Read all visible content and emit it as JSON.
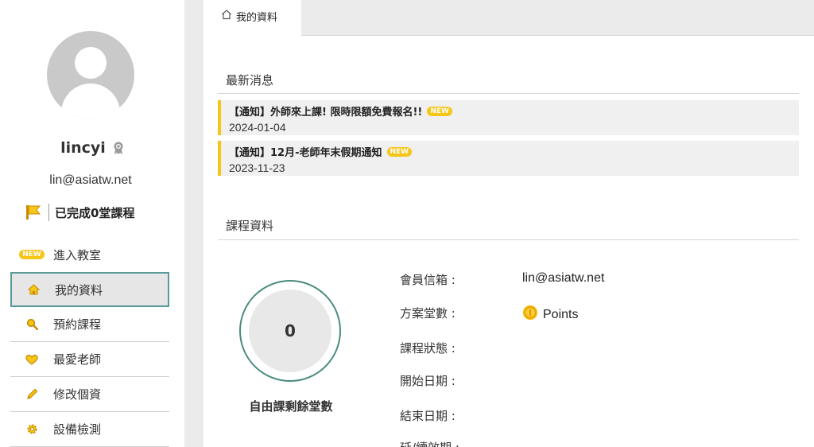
{
  "user": {
    "username": "lincyi",
    "email": "lin@asiatw.net",
    "completed_text": "已完成0堂課程"
  },
  "menu": [
    {
      "label": "進入教室",
      "icon": "new-badge",
      "badge": "NEW"
    },
    {
      "label": "我的資料",
      "icon": "home-icon"
    },
    {
      "label": "預約課程",
      "icon": "search-icon"
    },
    {
      "label": "最愛老師",
      "icon": "heart-icon"
    },
    {
      "label": "修改個資",
      "icon": "pencil-icon"
    },
    {
      "label": "設備檢測",
      "icon": "gear-icon"
    }
  ],
  "tab": {
    "label": "我的資料"
  },
  "news": {
    "title": "最新消息",
    "items": [
      {
        "title": "【通知】外師來上課! 限時限額免費報名!!",
        "date": "2024-01-04",
        "badge": "NEW"
      },
      {
        "title": "【通知】12月-老師年末假期通知",
        "date": "2023-11-23",
        "badge": "NEW"
      }
    ]
  },
  "course": {
    "title": "課程資料",
    "remaining_count": "0",
    "remaining_label": "自由課剩餘堂數",
    "fields": [
      {
        "label": "會員信箱 :",
        "value": "lin@asiatw.net"
      },
      {
        "label": "方案堂數 :",
        "value": "Points"
      },
      {
        "label": "課程狀態 :",
        "value": ""
      },
      {
        "label": "開始日期 :",
        "value": ""
      },
      {
        "label": "結束日期 :",
        "value": ""
      },
      {
        "label": "延/續效期 :",
        "value": ""
      }
    ]
  },
  "colors": {
    "accent": "#f5c518",
    "active_border": "#5c9a9a",
    "circle_border": "#4a8a7e"
  }
}
